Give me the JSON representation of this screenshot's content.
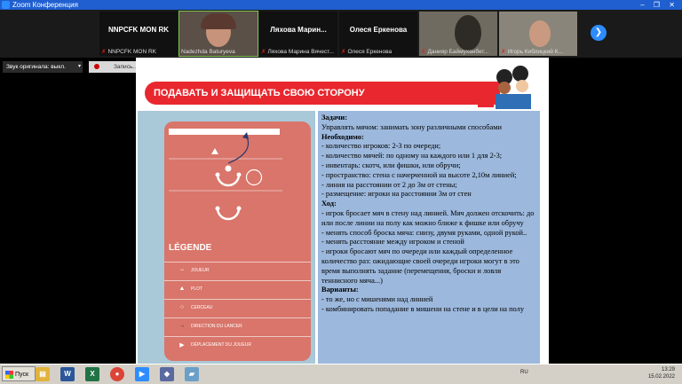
{
  "window": {
    "title": "Zoom Конференция",
    "controls": "– ❐ ✕"
  },
  "participants": [
    {
      "big": "NNPCFK MON RK",
      "name": "NNPCFK MON RK",
      "camera": false,
      "muted": true
    },
    {
      "big": "",
      "name": "Nadezhda Baturyeva",
      "camera": true,
      "muted": false,
      "selected": true
    },
    {
      "big": "Ляхова Марин...",
      "name": "Ляхова Марина Вячест...",
      "camera": false,
      "muted": true
    },
    {
      "big": "Олеся Еркенова",
      "name": "Олеся Еркенова",
      "camera": false,
      "muted": true
    },
    {
      "big": "",
      "name": "Данияр Баймуханбет...",
      "camera": true,
      "muted": true
    },
    {
      "big": "",
      "name": "Игорь Киблицкий  К...",
      "camera": true,
      "muted": true
    }
  ],
  "next_icon": "chevron-right-icon",
  "toolbar": {
    "original_sound": "Звук оригинала: выкл.",
    "dropdown": "▾",
    "record": "Запись..."
  },
  "slide": {
    "title": "ПОДАВАТЬ И ЗАЩИЩАТЬ СВОЮ СТОРОНУ",
    "legend_title": "LÉGENDE",
    "legend": [
      {
        "sym": "⌣",
        "label": "JOUEUR"
      },
      {
        "sym": "▲",
        "label": "PLOT"
      },
      {
        "sym": "○",
        "label": "CERCEAU"
      },
      {
        "sym": "→",
        "label": "DIRECTION DU LANCER"
      },
      {
        "sym": "▶",
        "label": "DÉPLACEMENT DU JOUEUR"
      }
    ],
    "text": [
      {
        "t": "Задачи:",
        "bold": true
      },
      {
        "t": "Управлять мячом: занимать зону различными способами",
        "bold": false
      },
      {
        "t": "Необходимо:",
        "bold": true
      },
      {
        "t": "- количество игроков: 2-3 по очереди;",
        "bold": false
      },
      {
        "t": "- количество мячей: по одному на каждого или 1 для 2-3;",
        "bold": false
      },
      {
        "t": "- инвентарь: скотч, или фишки, или обручи;",
        "bold": false
      },
      {
        "t": "- пространство: стена с начерченной на высоте 2,10м линией;",
        "bold": false
      },
      {
        "t": "- линия на расстоянии от 2 до 3м от стены;",
        "bold": false
      },
      {
        "t": "- размещение: игроки на расстоянии 3м от стен",
        "bold": false
      },
      {
        "t": "Ход:",
        "bold": true
      },
      {
        "t": "- игрок бросает мяч в стену над линией. Мяч должен отскочить: до или после линии на полу как можно ближе к фишке или обручу",
        "bold": false
      },
      {
        "t": "- менять способ броска мяча: снизу, двумя руками, одной рукой..",
        "bold": false
      },
      {
        "t": "- менять расстояние между игроком и стеной",
        "bold": false
      },
      {
        "t": "- игроки бросают мяч по очереди или каждый определенное количество раз: ожидающие своей очереди игроки могут в это время выполнять задание (перемещения, броски и ловля теннисного мяча...)",
        "bold": false
      },
      {
        "t": "Варианты:",
        "bold": true
      },
      {
        "t": "- то же, но с мишенями над линией",
        "bold": false
      },
      {
        "t": "- комбинировать попадание в мишени на стене и в цели на полу",
        "bold": false
      }
    ]
  },
  "taskbar": {
    "start": "Пуск",
    "apps": [
      {
        "icon": "folder-icon",
        "glyph": "▤",
        "color": "#e2b33c"
      },
      {
        "icon": "word-icon",
        "glyph": "W",
        "color": "#2b579a"
      },
      {
        "icon": "excel-icon",
        "glyph": "X",
        "color": "#217346"
      },
      {
        "icon": "chrome-icon",
        "glyph": "●",
        "color": "#db4437"
      },
      {
        "icon": "zoom-icon",
        "glyph": "▶",
        "color": "#2d8cff"
      },
      {
        "icon": "app-icon",
        "glyph": "◆",
        "color": "#5a6aa0"
      },
      {
        "icon": "notes-icon",
        "glyph": "▰",
        "color": "#6aa0c8"
      }
    ],
    "lang": "RU",
    "time": "13:29",
    "date": "15.02.2022"
  }
}
